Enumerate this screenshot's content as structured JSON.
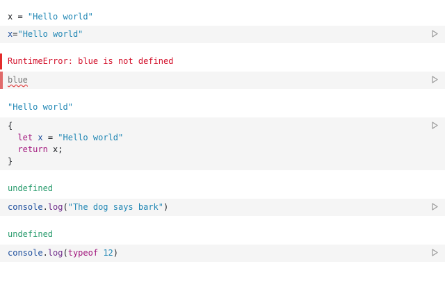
{
  "cells": [
    {
      "output": {
        "text": "x = \"Hello world\"",
        "parts": {
          "lhs": "x = ",
          "str": "\"Hello world\""
        }
      },
      "input": {
        "var": "x",
        "eq": "=",
        "str": "\"Hello world\""
      }
    },
    {
      "output": {
        "error": "RuntimeError: blue is not defined"
      },
      "input": {
        "code": "blue"
      }
    },
    {
      "output": {
        "str": "\"Hello world\""
      },
      "input": {
        "open": "{",
        "line1_kw": "let",
        "line1_var": "x",
        "line1_eq": " = ",
        "line1_str": "\"Hello world\"",
        "line2_kw": "return",
        "line2_rest": "x;",
        "close": "}"
      }
    },
    {
      "output": {
        "text": "undefined"
      },
      "input": {
        "obj": "console",
        "dot": ".",
        "fn": "log",
        "open": "(",
        "str": "\"The dog says bark\"",
        "close": ")"
      }
    },
    {
      "output": {
        "text": "undefined"
      },
      "input": {
        "obj": "console",
        "dot": ".",
        "fn": "log",
        "open": "(",
        "kw": "typeof",
        "num": "12",
        "close": ")"
      }
    }
  ],
  "icons": {
    "run": "play-icon"
  },
  "colors": {
    "error": "#e32b2b",
    "string": "#1f86b4",
    "keyword": "#a1157c",
    "undefined": "#2a9c6e",
    "cell_bg": "#f5f5f5"
  }
}
